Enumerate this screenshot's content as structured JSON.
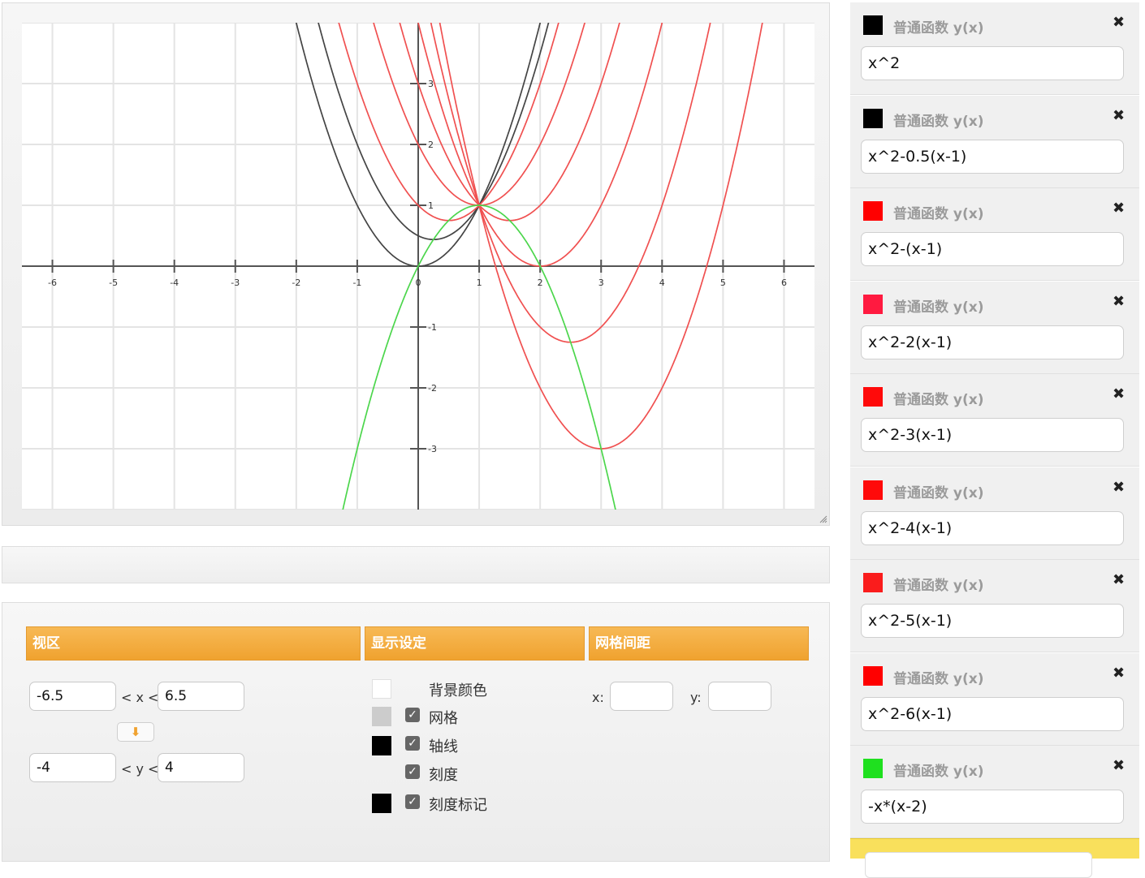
{
  "functions": [
    {
      "type_label": "普通函数 y(x)",
      "expression": "x^2",
      "color": "#000000"
    },
    {
      "type_label": "普通函数 y(x)",
      "expression": "x^2-0.5(x-1)",
      "color": "#000000"
    },
    {
      "type_label": "普通函数 y(x)",
      "expression": "x^2-(x-1)",
      "color": "#ff0000"
    },
    {
      "type_label": "普通函数 y(x)",
      "expression": "x^2-2(x-1)",
      "color": "#ff1a40"
    },
    {
      "type_label": "普通函数 y(x)",
      "expression": "x^2-3(x-1)",
      "color": "#ff0a0a"
    },
    {
      "type_label": "普通函数 y(x)",
      "expression": "x^2-4(x-1)",
      "color": "#ff0a0a"
    },
    {
      "type_label": "普通函数 y(x)",
      "expression": "x^2-5(x-1)",
      "color": "#fa1c1c"
    },
    {
      "type_label": "普通函数 y(x)",
      "expression": "x^2-6(x-1)",
      "color": "#ff0000"
    },
    {
      "type_label": "普通函数 y(x)",
      "expression": "-x*(x-2)",
      "color": "#1fe01f"
    }
  ],
  "settings": {
    "viewport": {
      "header": "视区",
      "x_min": "-6.5",
      "x_max": "6.5",
      "y_min": "-4",
      "y_max": "4",
      "x_rel": "< x <",
      "y_rel": "< y <",
      "swap_icon": "arrow-down-icon",
      "swap_glyph": "⬇"
    },
    "display": {
      "header": "显示设定",
      "background_label": "背景颜色",
      "grid_label": "网格",
      "axes_label": "轴线",
      "ticks_label": "刻度",
      "tick_labels_label": "刻度标记",
      "background_color": "#ffffff",
      "grid_color": "#cccccc",
      "axes_color": "#000000",
      "tick_label_color": "#000000",
      "grid_checked": true,
      "axes_checked": true,
      "ticks_checked": true,
      "tick_labels_checked": true
    },
    "grid_spacing": {
      "header": "网格间距",
      "x_label": "x:",
      "y_label": "y:",
      "x_value": "",
      "y_value": ""
    }
  },
  "chart_data": {
    "type": "line",
    "xlim": [
      -6.5,
      6.5
    ],
    "ylim": [
      -4,
      4
    ],
    "grid": true,
    "x_ticks": [
      "-6",
      "-5",
      "-4",
      "-3",
      "-2",
      "-1",
      "0",
      "1",
      "2",
      "3",
      "4",
      "5",
      "6"
    ],
    "y_ticks": [
      "-3",
      "-2",
      "-1",
      "0",
      "1",
      "2",
      "3"
    ],
    "series": [
      {
        "expr": "x^2",
        "a": 0,
        "color": "#444444"
      },
      {
        "expr": "x^2-0.5(x-1)",
        "a": 0.5,
        "color": "#444444"
      },
      {
        "expr": "x^2-(x-1)",
        "a": 1,
        "color": "#f05050"
      },
      {
        "expr": "x^2-2(x-1)",
        "a": 2,
        "color": "#f05050"
      },
      {
        "expr": "x^2-3(x-1)",
        "a": 3,
        "color": "#f05050"
      },
      {
        "expr": "x^2-4(x-1)",
        "a": 4,
        "color": "#f05050"
      },
      {
        "expr": "x^2-5(x-1)",
        "a": 5,
        "color": "#f05050"
      },
      {
        "expr": "x^2-6(x-1)",
        "a": 6,
        "color": "#f05050"
      },
      {
        "expr": "-x*(x-2)",
        "a": null,
        "color": "#4cd64c"
      }
    ]
  }
}
